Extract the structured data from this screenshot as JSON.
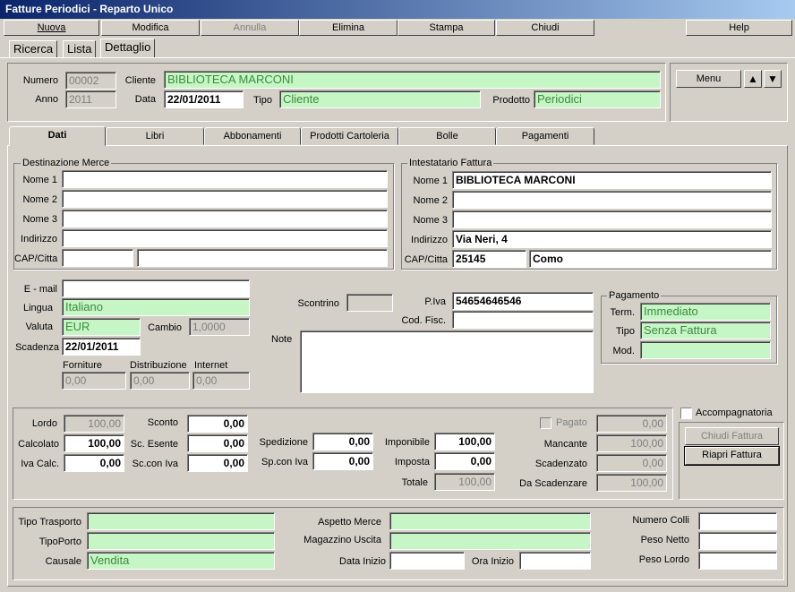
{
  "window": {
    "title": "Fatture Periodici - Reparto Unico"
  },
  "toolbar": {
    "nuova": "Nuova",
    "modifica": "Modifica",
    "annulla": "Annulla",
    "elimina": "Elimina",
    "stampa": "Stampa",
    "chiudi": "Chiudi",
    "help": "Help"
  },
  "page_tabs": {
    "ricerca": "Ricerca",
    "lista": "Lista",
    "dettaglio": "Dettaglio"
  },
  "header": {
    "numero_label": "Numero",
    "numero": "00002",
    "anno_label": "Anno",
    "anno": "2011",
    "cliente_label": "Cliente",
    "cliente": "BIBLIOTECA MARCONI",
    "data_label": "Data",
    "data": "22/01/2011",
    "tipo_label": "Tipo",
    "tipo": "Cliente",
    "prodotto_label": "Prodotto",
    "prodotto": "Periodici",
    "menu": "Menu",
    "up": "▲",
    "down": "▼"
  },
  "tabs": {
    "dati": "Dati",
    "libri": "Libri",
    "abbonamenti": "Abbonamenti",
    "cartoleria": "Prodotti Cartoleria",
    "bolle": "Bolle",
    "pagamenti": "Pagamenti"
  },
  "destinazione": {
    "title": "Destinazione Merce",
    "nome1": "Nome 1",
    "nome2": "Nome 2",
    "nome3": "Nome 3",
    "indirizzo": "Indirizzo",
    "cap": "CAP/Citta"
  },
  "intestatario": {
    "title": "Intestatario Fattura",
    "nome1_label": "Nome 1",
    "nome1": "BIBLIOTECA MARCONI",
    "nome2_label": "Nome 2",
    "nome3_label": "Nome 3",
    "indirizzo_label": "Indirizzo",
    "indirizzo": "Via Neri, 4",
    "cap_label": "CAP/Citta",
    "cap": "25145",
    "citta": "Como"
  },
  "misc": {
    "email_label": "E - mail",
    "lingua_label": "Lingua",
    "lingua": "Italiano",
    "valuta_label": "Valuta",
    "valuta": "EUR",
    "cambio_label": "Cambio",
    "cambio": "1,0000",
    "scadenza_label": "Scadenza",
    "scadenza": "22/01/2011",
    "forniture_label": "Forniture",
    "forniture": "0,00",
    "distribuzione_label": "Distribuzione",
    "distribuzione": "0,00",
    "internet_label": "Internet",
    "internet": "0,00",
    "scontrino_label": "Scontrino",
    "piva_label": "P.Iva",
    "piva": "54654646546",
    "codfisc_label": "Cod. Fisc.",
    "note_label": "Note"
  },
  "pagamento": {
    "title": "Pagamento",
    "term_label": "Term.",
    "term": "Immediato",
    "tipo_label": "Tipo",
    "tipo": "Senza Fattura",
    "mod_label": "Mod."
  },
  "totali": {
    "lordo_label": "Lordo",
    "lordo": "100,00",
    "calcolato_label": "Calcolato",
    "calcolato": "100,00",
    "iva_label": "Iva Calc.",
    "iva": "0,00",
    "sconto_label": "Sconto",
    "sconto": "0,00",
    "scesente_label": "Sc. Esente",
    "scesente": "0,00",
    "sciva_label": "Sc.con Iva",
    "sciva": "0,00",
    "spedizione_label": "Spedizione",
    "spedizione": "0,00",
    "spiva_label": "Sp.con Iva",
    "spiva": "0,00",
    "imponibile_label": "Imponibile",
    "imponibile": "100,00",
    "imposta_label": "Imposta",
    "imposta": "0,00",
    "totale_label": "Totale",
    "totale": "100,00",
    "pagato_label": "Pagato",
    "pagato": "0,00",
    "mancante_label": "Mancante",
    "mancante": "100,00",
    "scadenzato_label": "Scadenzato",
    "scadenzato": "0,00",
    "dascad_label": "Da Scadenzare",
    "dascad": "100,00",
    "accompagnatoria": "Accompagnatoria",
    "chiudi_fattura": "Chiudi Fattura",
    "riapri_fattura": "Riapri Fattura"
  },
  "trasporto": {
    "tipo_label": "Tipo Trasporto",
    "porto_label": "TipoPorto",
    "causale_label": "Causale",
    "causale": "Vendita",
    "aspetto_label": "Aspetto Merce",
    "magazzino_label": "Magazzino Uscita",
    "datainizio_label": "Data Inizio",
    "orainizio_label": "Ora Inizio",
    "colli_label": "Numero Colli",
    "netto_label": "Peso Netto",
    "lordo_label": "Peso Lordo"
  }
}
